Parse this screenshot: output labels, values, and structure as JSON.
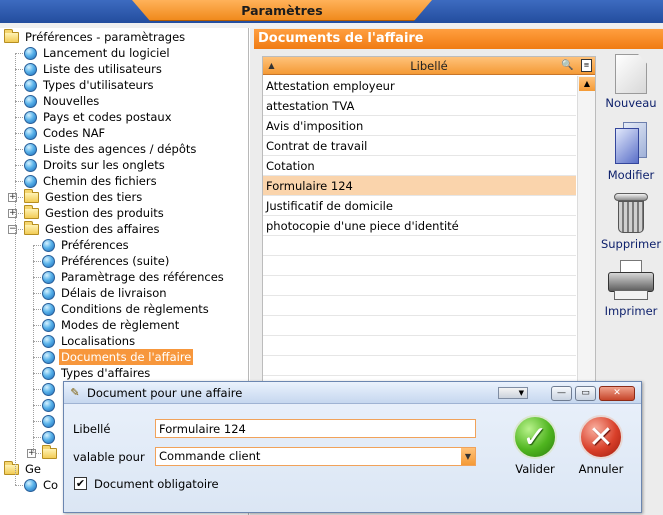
{
  "window_title": "Paramètres",
  "tree": {
    "nodes": [
      {
        "label": "Préférences - paramètrages",
        "type": "folder",
        "level": 0,
        "expand": "minus"
      },
      {
        "label": "Lancement du logiciel",
        "type": "globe",
        "level": 1
      },
      {
        "label": "Liste des utilisateurs",
        "type": "globe",
        "level": 1
      },
      {
        "label": "Types d'utilisateurs",
        "type": "globe",
        "level": 1
      },
      {
        "label": "Nouvelles",
        "type": "globe",
        "level": 1
      },
      {
        "label": "Pays et codes postaux",
        "type": "globe",
        "level": 1
      },
      {
        "label": "Codes NAF",
        "type": "globe",
        "level": 1
      },
      {
        "label": "Liste des agences / dépôts",
        "type": "globe",
        "level": 1
      },
      {
        "label": "Droits sur les onglets",
        "type": "globe",
        "level": 1
      },
      {
        "label": "Chemin des fichiers",
        "type": "globe",
        "level": 1
      },
      {
        "label": "Gestion des tiers",
        "type": "folder",
        "level": 1,
        "expand": "plus"
      },
      {
        "label": "Gestion des produits",
        "type": "folder",
        "level": 1,
        "expand": "plus"
      },
      {
        "label": "Gestion des affaires",
        "type": "folder",
        "level": 1,
        "expand": "minus"
      },
      {
        "label": "Préférences",
        "type": "globe",
        "level": 2
      },
      {
        "label": "Préférences (suite)",
        "type": "globe",
        "level": 2
      },
      {
        "label": "Paramètrage des références",
        "type": "globe",
        "level": 2
      },
      {
        "label": "Délais de livraison",
        "type": "globe",
        "level": 2
      },
      {
        "label": "Conditions de règlements",
        "type": "globe",
        "level": 2
      },
      {
        "label": "Modes de règlement",
        "type": "globe",
        "level": 2
      },
      {
        "label": "Localisations",
        "type": "globe",
        "level": 2
      },
      {
        "label": "Documents de l'affaire",
        "type": "globe",
        "level": 2,
        "selected": true
      },
      {
        "label": "Types d'affaires",
        "type": "globe",
        "level": 2
      },
      {
        "label": "",
        "type": "globe",
        "level": 2
      },
      {
        "label": "",
        "type": "globe",
        "level": 2
      },
      {
        "label": "",
        "type": "globe",
        "level": 2
      },
      {
        "label": "",
        "type": "globe",
        "level": 2
      },
      {
        "label": "",
        "type": "folder",
        "level": 2,
        "expand": "plus"
      },
      {
        "label": "Ge",
        "type": "folder",
        "level": 0,
        "expand": "plus"
      },
      {
        "label": "Co",
        "type": "globe",
        "level": 1
      }
    ]
  },
  "section_title": "Documents de l'affaire",
  "list": {
    "column_header": "Libellé",
    "rows": [
      "Attestation employeur",
      "attestation TVA",
      "Avis d'imposition",
      "Contrat de travail",
      "Cotation",
      "Formulaire 124",
      "Justificatif de domicile",
      "photocopie d'une piece d'identité",
      "",
      "",
      "",
      "",
      "",
      "",
      "",
      "",
      ""
    ],
    "selected_index": 5
  },
  "actions": {
    "new": "Nouveau",
    "edit": "Modifier",
    "delete": "Supprimer",
    "print": "Imprimer"
  },
  "dialog": {
    "title": "Document pour une affaire",
    "libelle_label": "Libellé",
    "libelle_value": "Formulaire 124",
    "valid_for_label": "valable pour",
    "valid_for_value": "Commande client",
    "mandatory_label": "Document obligatoire",
    "mandatory_checked": true,
    "validate_label": "Valider",
    "cancel_label": "Annuler"
  },
  "colors": {
    "accent_orange": "#f07b13",
    "title_bar_blue": "#234d9e",
    "selection": "#f7973c"
  }
}
